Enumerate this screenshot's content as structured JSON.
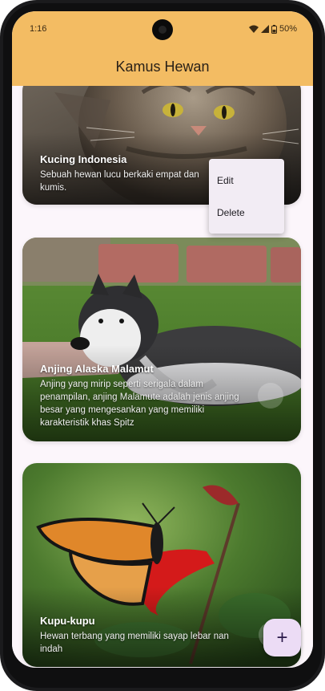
{
  "status_bar": {
    "time": "1:16",
    "battery": "50%"
  },
  "app": {
    "title": "Kamus Hewan"
  },
  "cards": [
    {
      "title": "Kucing Indonesia",
      "description": "Sebuah hewan lucu berkaki empat dan kumis."
    },
    {
      "title": "Anjing Alaska Malamut",
      "description": "Anjing yang mirip seperti serigala dalam penampilan, anjing Malamute adalah jenis anjing besar yang mengesankan yang memiliki karakteristik khas Spitz"
    },
    {
      "title": "Kupu-kupu",
      "description": "Hewan terbang yang memiliki sayap lebar nan indah"
    }
  ],
  "popup_menu": {
    "edit": "Edit",
    "delete": "Delete"
  },
  "fab": {
    "icon": "plus-icon",
    "label": "+"
  },
  "colors": {
    "app_bar": "#f3bc63",
    "fab": "#ecdcf5",
    "background": "#fcf6fb"
  }
}
